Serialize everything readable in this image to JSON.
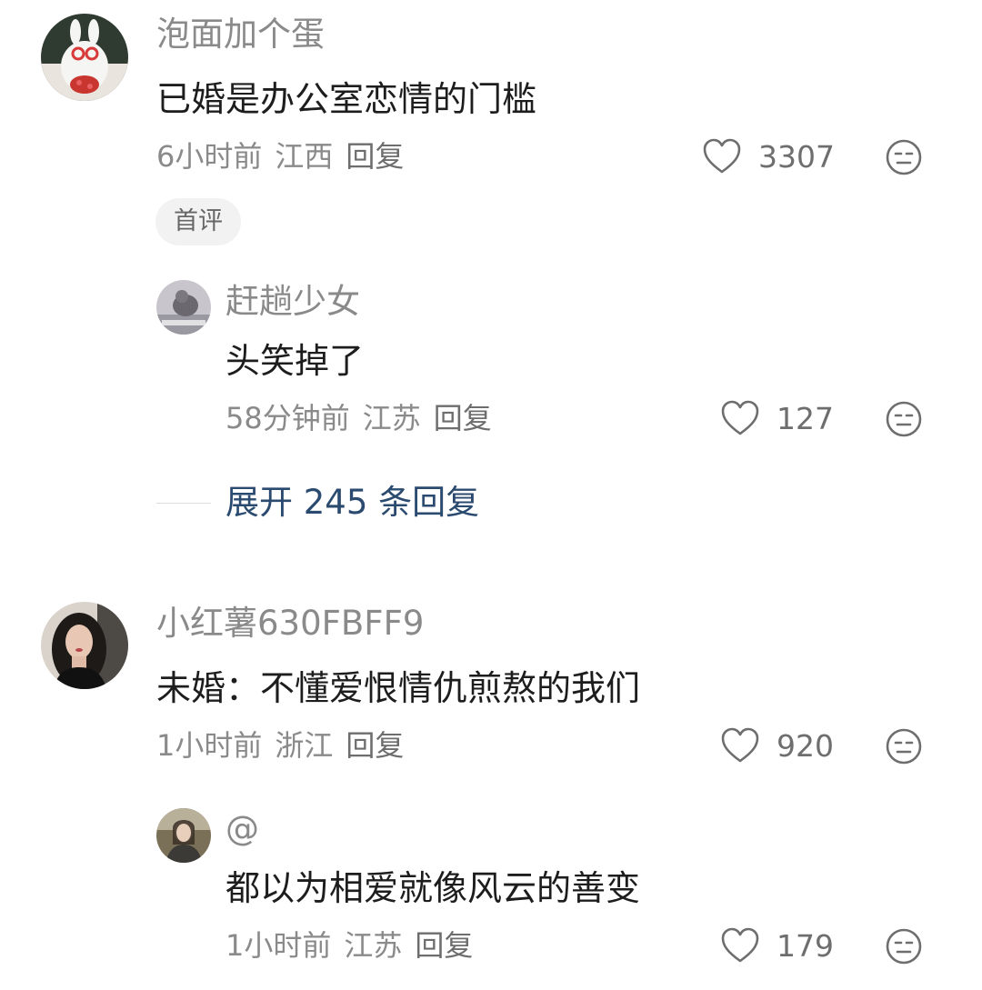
{
  "comments": [
    {
      "username": "泡面加个蛋",
      "content": "已婚是办公室恋情的门槛",
      "time": "6小时前",
      "location": "江西",
      "reply_label": "回复",
      "likes": "3307",
      "badge": "首评",
      "avatar_icon": "bunny-doll-avatar",
      "replies": [
        {
          "username": "赶趟少女",
          "content": "头笑掉了",
          "time": "58分钟前",
          "location": "江苏",
          "reply_label": "回复",
          "likes": "127",
          "avatar_icon": "cat-photo-avatar"
        }
      ],
      "expand_label": "展开 245 条回复"
    },
    {
      "username": "小红薯630FBFF9",
      "content": "未婚：不懂爱恨情仇煎熬的我们",
      "time": "1小时前",
      "location": "浙江",
      "reply_label": "回复",
      "likes": "920",
      "avatar_icon": "woman-portrait-avatar",
      "replies": [
        {
          "username": "@",
          "content": "都以为相爱就像风云的善变",
          "time": "1小时前",
          "location": "江苏",
          "reply_label": "回复",
          "likes": "179",
          "avatar_icon": "person-photo-avatar"
        }
      ]
    }
  ],
  "colors": {
    "meta_gray": "#8a8a8a",
    "expand_blue": "#2b4a6f",
    "badge_bg": "#f2f2f2"
  }
}
